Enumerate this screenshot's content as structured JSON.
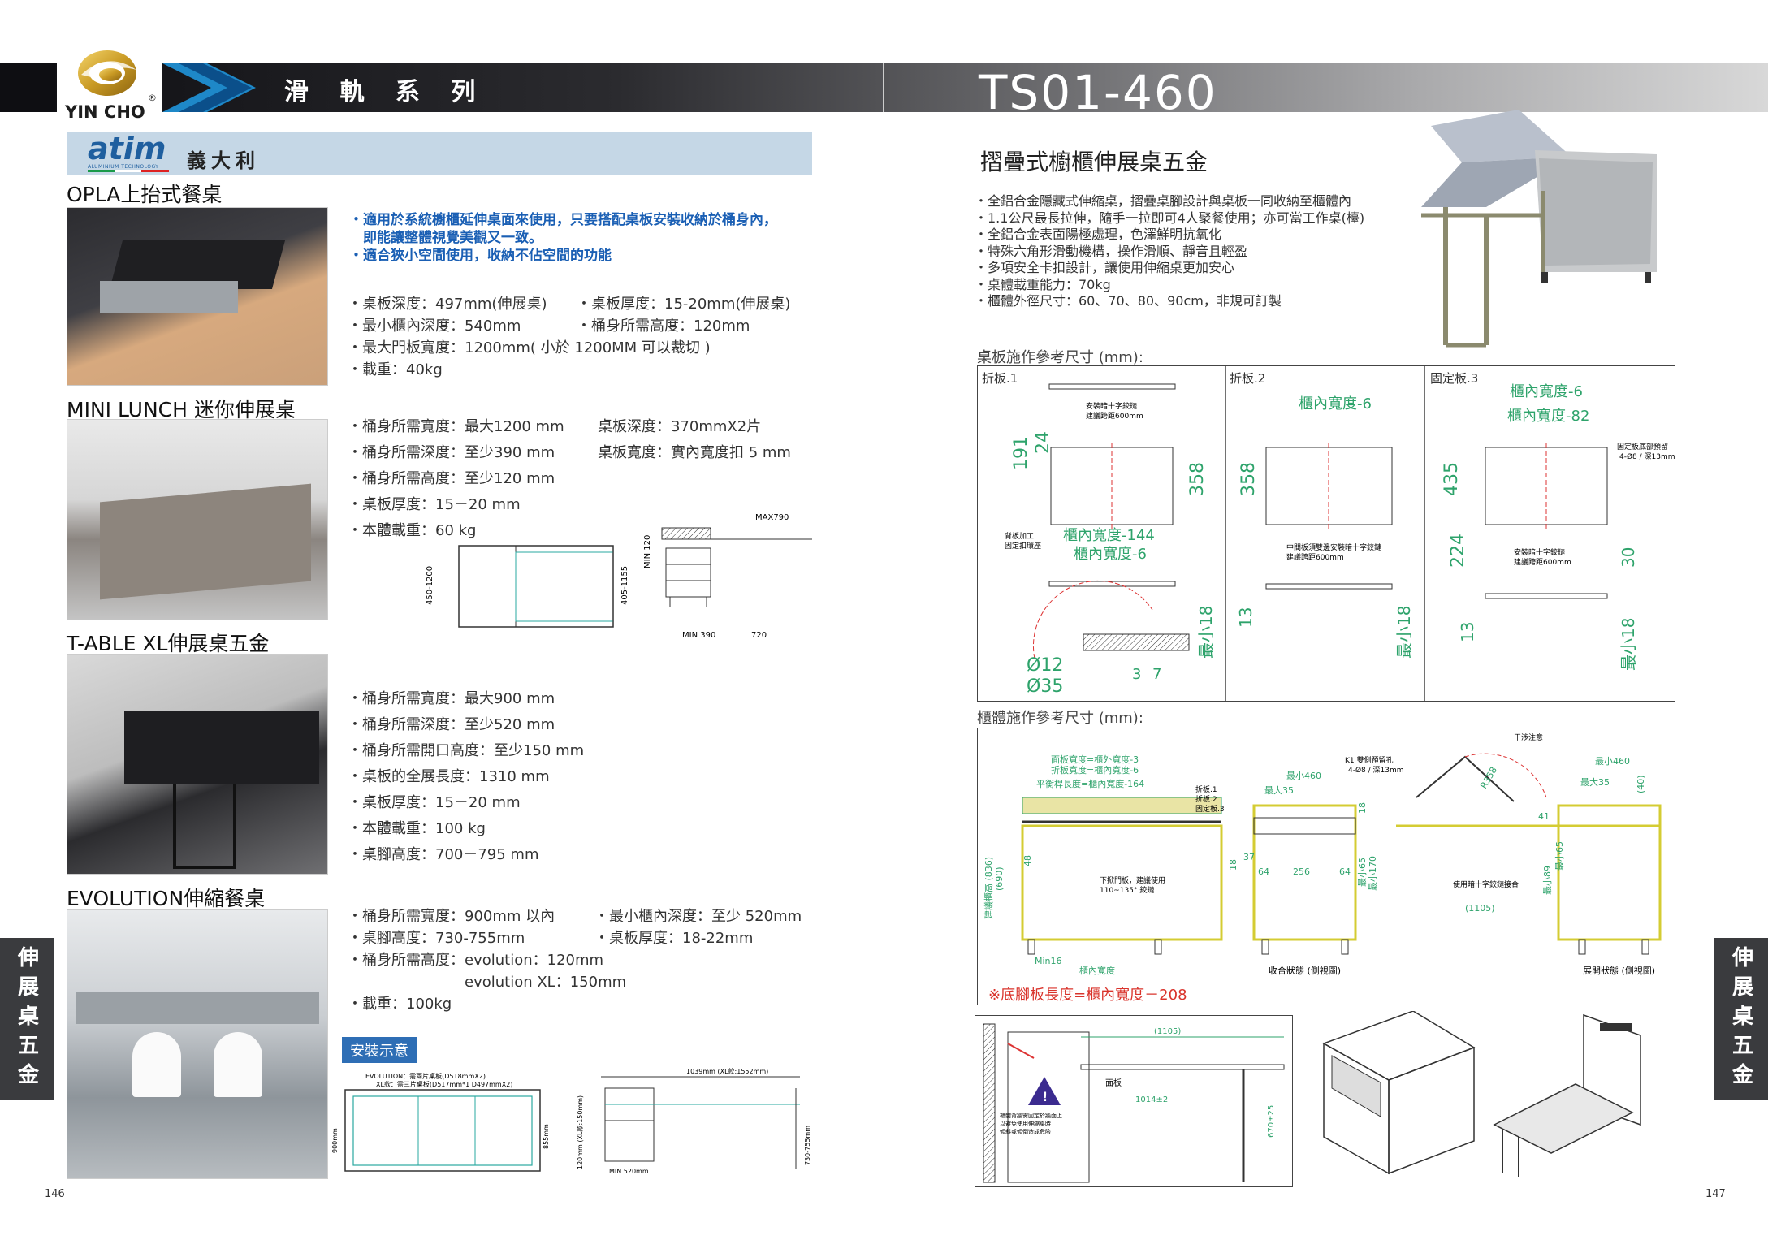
{
  "header": {
    "brand": "YIN CHO",
    "registered": "®",
    "series": "滑 軌 系 列",
    "model": "TS01-460"
  },
  "brand_band": {
    "logo_text": "atim",
    "logo_sub": "ALUMINIUM TECHNOLOGY",
    "origin": "義大利"
  },
  "colors": {
    "header_dark": "#0e0e12",
    "band": "#c5d7e6",
    "blue_text": "#1a5fb4",
    "dim_green": "#2ea36b",
    "red_note": "#d9332b",
    "side_tab": "#3a3b3e"
  },
  "left_page": {
    "opla": {
      "title": "OPLA上抬式餐桌",
      "highlights": [
        "・適用於系統櫥櫃延伸桌面來使用，只要搭配桌板安裝收納於桶身內，",
        "　即能讓整體視覺美觀又一致。",
        "・適合狹小空間使用，收納不佔空間的功能"
      ],
      "specs_left": [
        "・桌板深度：497mm(伸展桌)",
        "・最小櫃內深度：540mm",
        "・最大門板寬度：1200mm( 小於 1200MM 可以裁切 )",
        "・載重：40kg"
      ],
      "specs_right": [
        "・桌板厚度：15-20mm(伸展桌)",
        "・桶身所需高度：120mm"
      ]
    },
    "mini_lunch": {
      "title": "MINI LUNCH 迷你伸展桌",
      "specs_left": [
        "・桶身所需寬度：最大1200 mm",
        "・桶身所需深度：至少390 mm",
        "・桶身所需高度：至少120 mm",
        "・桌板厚度：15－20 mm",
        "・本體載重：60 kg"
      ],
      "specs_right": [
        "桌板深度：370mmX2片",
        "桌板寬度：實內寬度扣 5 mm"
      ],
      "drawing_labels": {
        "max": "MAX790",
        "h1": "450-1200",
        "h2": "405-1155",
        "min120": "MIN 120",
        "min390": "MIN 390",
        "w720": "720"
      }
    },
    "t_able": {
      "title": "T-ABLE XL伸展桌五金",
      "specs": [
        "・桶身所需寬度：最大900 mm",
        "・桶身所需深度：至少520 mm",
        "・桶身所需開口高度：至少150 mm",
        "・桌板的全展長度：1310 mm",
        "・桌板厚度：15－20 mm",
        "・本體載重：100 kg",
        "・桌腳高度：700－795 mm"
      ]
    },
    "evolution": {
      "title": "EVOLUTION伸縮餐桌",
      "specs_left": [
        "・桶身所需寬度：900mm 以內",
        "・桌腳高度：730-755mm",
        "・桶身所需高度：evolution：120mm",
        "　　　　　　　　evolution XL：150mm",
        "・載重：100kg"
      ],
      "specs_right": [
        "・最小櫃內深度：至少 520mm",
        "・桌板厚度：18-22mm"
      ],
      "install_label": "安裝示意",
      "drawing_labels": {
        "note1": "EVOLUTION：需兩片桌板(D518mmX2)",
        "note2": "XL款：需三片桌板(D517mm*1 D497mmX2)",
        "w": "1039mm (XL款:1552mm)",
        "h900": "900mm",
        "h855": "855mm",
        "h120": "120mm (XL款:150mm)",
        "h730": "730-755mm",
        "min520": "MIN 520mm"
      }
    },
    "side_tab": "伸展桌五金",
    "page_number": "146"
  },
  "right_page": {
    "title": "摺疊式櫥櫃伸展桌五金",
    "features": [
      "・全鋁合金隱藏式伸縮桌，摺疊桌腳設計與桌板一同收納至櫃體內",
      "・1.1公尺最長拉伸，隨手一拉即可4人聚餐使用；亦可當工作桌(檯)",
      "・全鋁合金表面陽極處理，色澤鮮明抗氧化",
      "・特殊六角形滑動機構，操作滑順、靜音且輕盈",
      "・多項安全卡扣設計，讓使用伸縮桌更加安心",
      "・桌體載重能力：70kg",
      "・櫃體外徑尺寸：60、70、80、90cm，非規可訂製"
    ],
    "board_caption": "桌板施作參考尺寸 (mm):",
    "board_panels": [
      {
        "name": "折板.1",
        "labels": [
          "安裝暗十字鉸鏈",
          "建議跨距600mm",
          "191",
          "24",
          "358",
          "背板加工",
          "固定扣環座",
          "櫃內寬度-144",
          "櫃內寬度-6",
          "Ø12",
          "Ø35",
          "3",
          "7",
          "最小18"
        ]
      },
      {
        "name": "折板.2",
        "labels": [
          "櫃內寬度-6",
          "358",
          "中間板須雙邊安裝暗十字鉸鏈",
          "建議跨距600mm",
          "13",
          "最小18"
        ]
      },
      {
        "name": "固定板.3",
        "labels": [
          "櫃內寬度-6",
          "櫃內寬度-82",
          "固定板底部預留",
          "4-Ø8 / 深13mm",
          "435",
          "224",
          "安裝暗十字鉸鏈",
          "建議跨距600mm",
          "30",
          "13",
          "最小18"
        ]
      }
    ],
    "cabinet_caption": "櫃體施作參考尺寸 (mm):",
    "cabinet_labels": {
      "l1": "面板寬度=櫃外寬度-3",
      "l2": "折板寬度=櫃內寬度-6",
      "l3": "平衡桿長度=櫃內寬度-164",
      "p1": "折板.1",
      "p2": "折板.2",
      "p3": "固定板.3",
      "h836": "建議櫃高 (836)",
      "h690": "(690)",
      "v48": "48",
      "v18": "18",
      "hinge": "下掀門板，建議使用",
      "hinge2": "110~135° 鉸鏈",
      "min16": "Min16",
      "inner": "櫃內寬度",
      "min460": "最小460",
      "max35": "最大35",
      "k1": "K1 雙側預留孔",
      "k1b": "4-Ø8 / 深13mm",
      "v37": "37",
      "v64": "64",
      "v256": "256",
      "min65": "最小65",
      "min170": "最小170",
      "v18b": "18",
      "closed": "收合狀態 (側視圖)",
      "caution": "干涉注意",
      "r358": "R358",
      "min460b": "最小460",
      "max35b": "最大35",
      "v40": "(40)",
      "v41": "41",
      "min89": "最小89",
      "min65b": "最小65",
      "hinge3": "使用暗十字鉸鏈接合",
      "w1105": "(1105)",
      "open": "展開狀態 (側視圖)"
    },
    "red_note": "※底腳板長度=櫃內寬度－208",
    "warning_labels": {
      "w1105": "(1105)",
      "sub": "面板",
      "w1014": "1014±2",
      "h670": "670±25",
      "warn": "櫃體背牆需固定於牆面上",
      "warn2": "以避免使用伸縮桌時",
      "warn3": "傾斜或傾倒造成危險"
    },
    "side_tab": "伸展桌五金",
    "page_number": "147"
  }
}
